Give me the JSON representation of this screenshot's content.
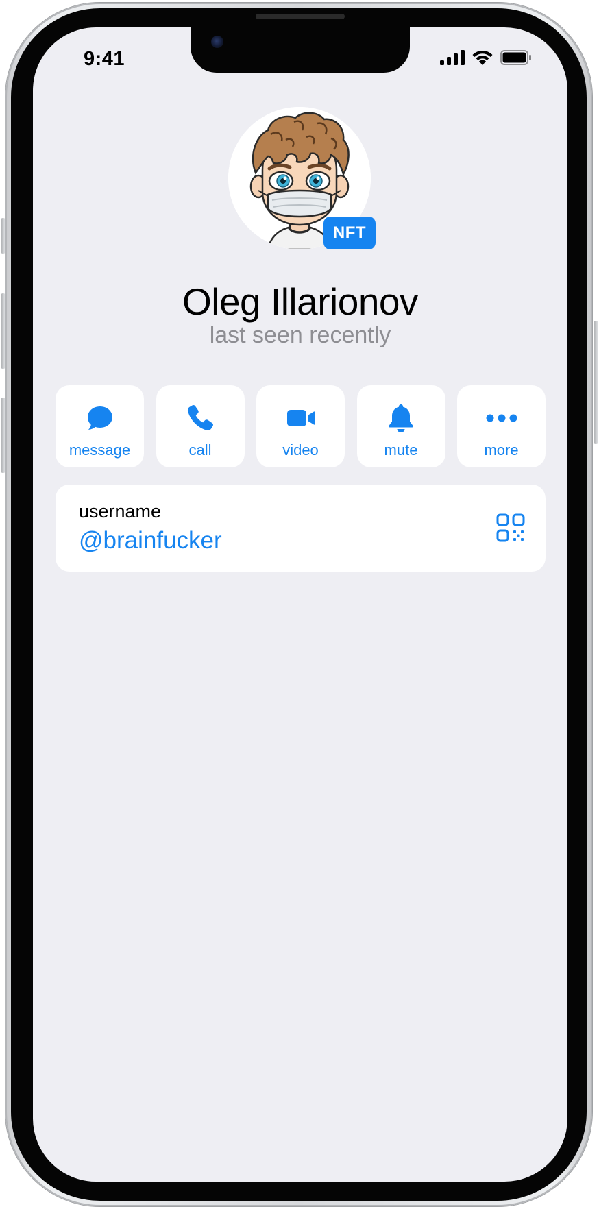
{
  "status_bar": {
    "time": "9:41"
  },
  "profile": {
    "name": "Oleg Illarionov",
    "status": "last seen recently",
    "badge": "NFT"
  },
  "actions": [
    {
      "label": "message",
      "icon": "chat-bubble-icon"
    },
    {
      "label": "call",
      "icon": "phone-icon"
    },
    {
      "label": "video",
      "icon": "video-camera-icon"
    },
    {
      "label": "mute",
      "icon": "bell-icon"
    },
    {
      "label": "more",
      "icon": "ellipsis-icon"
    }
  ],
  "info": {
    "username_label": "username",
    "username_value": "@brainfucker"
  },
  "colors": {
    "accent": "#1684f0",
    "background": "#eeeef3",
    "card": "#ffffff",
    "secondary_text": "#8e8e93"
  }
}
